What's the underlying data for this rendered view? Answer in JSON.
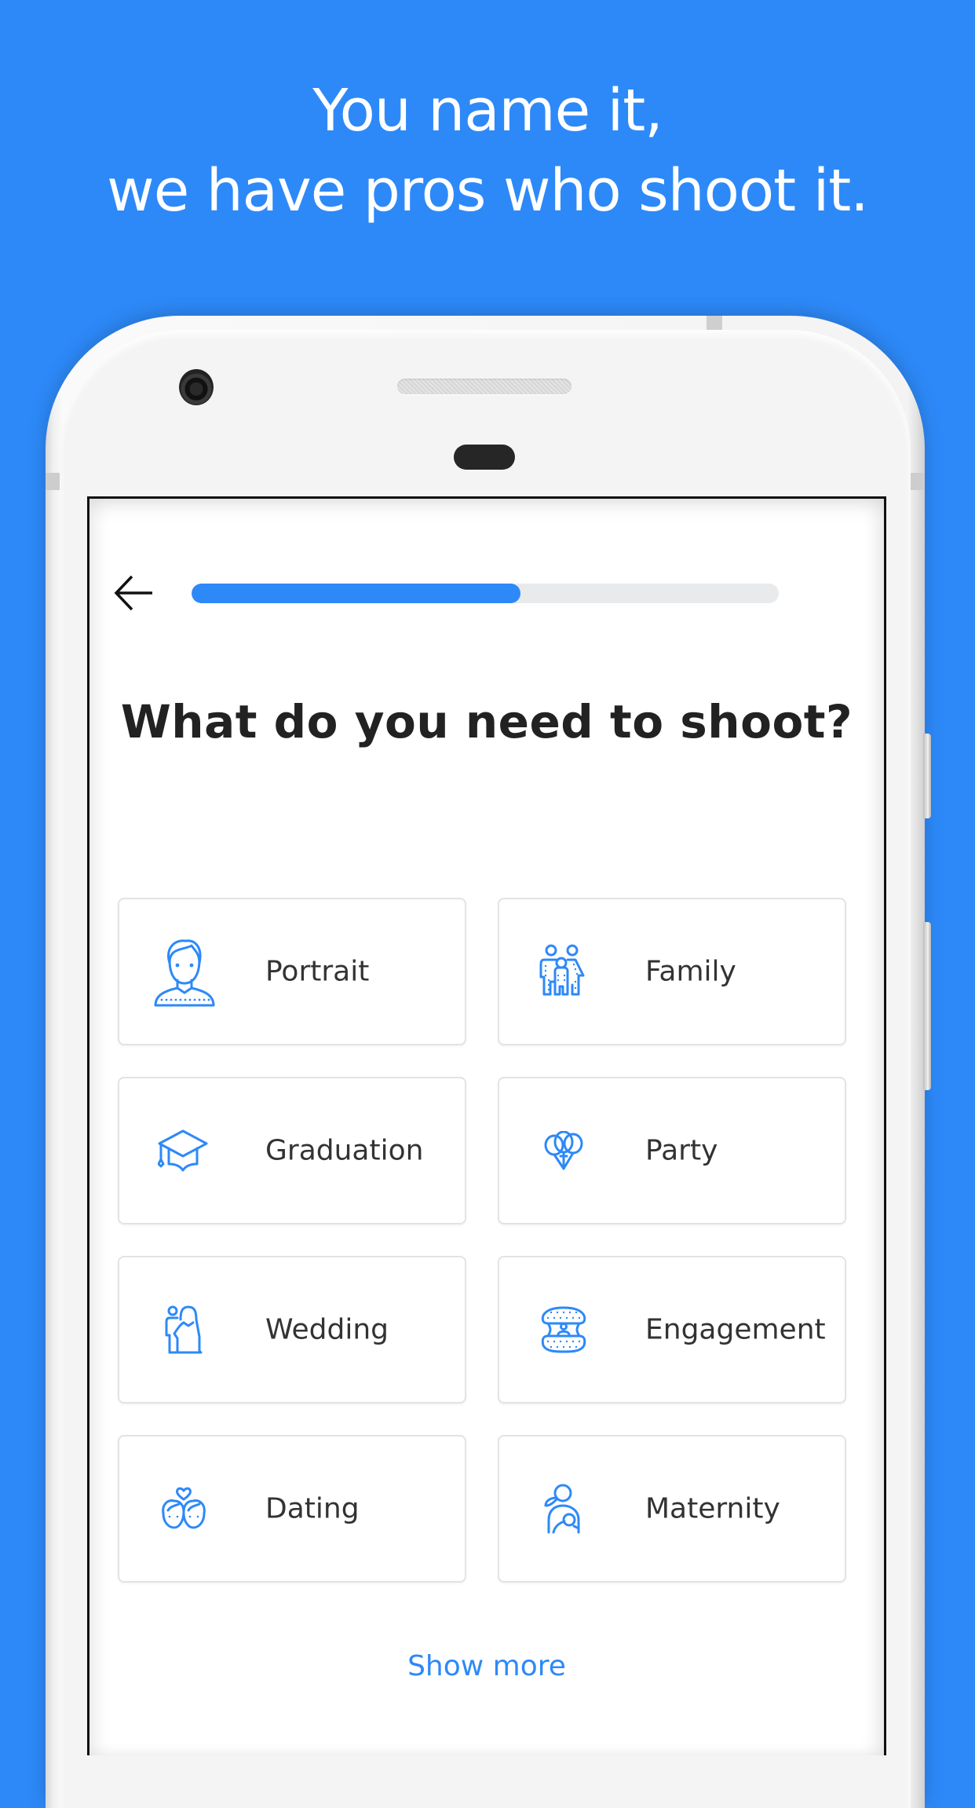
{
  "headline": {
    "line1": "You name it,",
    "line2": "we have pros who shoot it."
  },
  "colors": {
    "brand_blue": "#2d89f8",
    "progress_track": "#e8eaec",
    "text_dark": "#222222"
  },
  "screen": {
    "back_icon": "arrow-left-icon",
    "progress": {
      "value": 0.56,
      "label": "56%"
    },
    "title": "What do you need to shoot?",
    "categories": [
      {
        "label": "Portrait",
        "icon": "portrait-icon"
      },
      {
        "label": "Family",
        "icon": "family-icon"
      },
      {
        "label": "Graduation",
        "icon": "graduation-cap-icon"
      },
      {
        "label": "Party",
        "icon": "balloons-icon"
      },
      {
        "label": "Wedding",
        "icon": "wedding-couple-icon"
      },
      {
        "label": "Engagement",
        "icon": "ring-box-icon"
      },
      {
        "label": "Dating",
        "icon": "couple-heart-icon"
      },
      {
        "label": "Maternity",
        "icon": "mother-baby-icon"
      }
    ],
    "show_more_label": "Show more"
  }
}
